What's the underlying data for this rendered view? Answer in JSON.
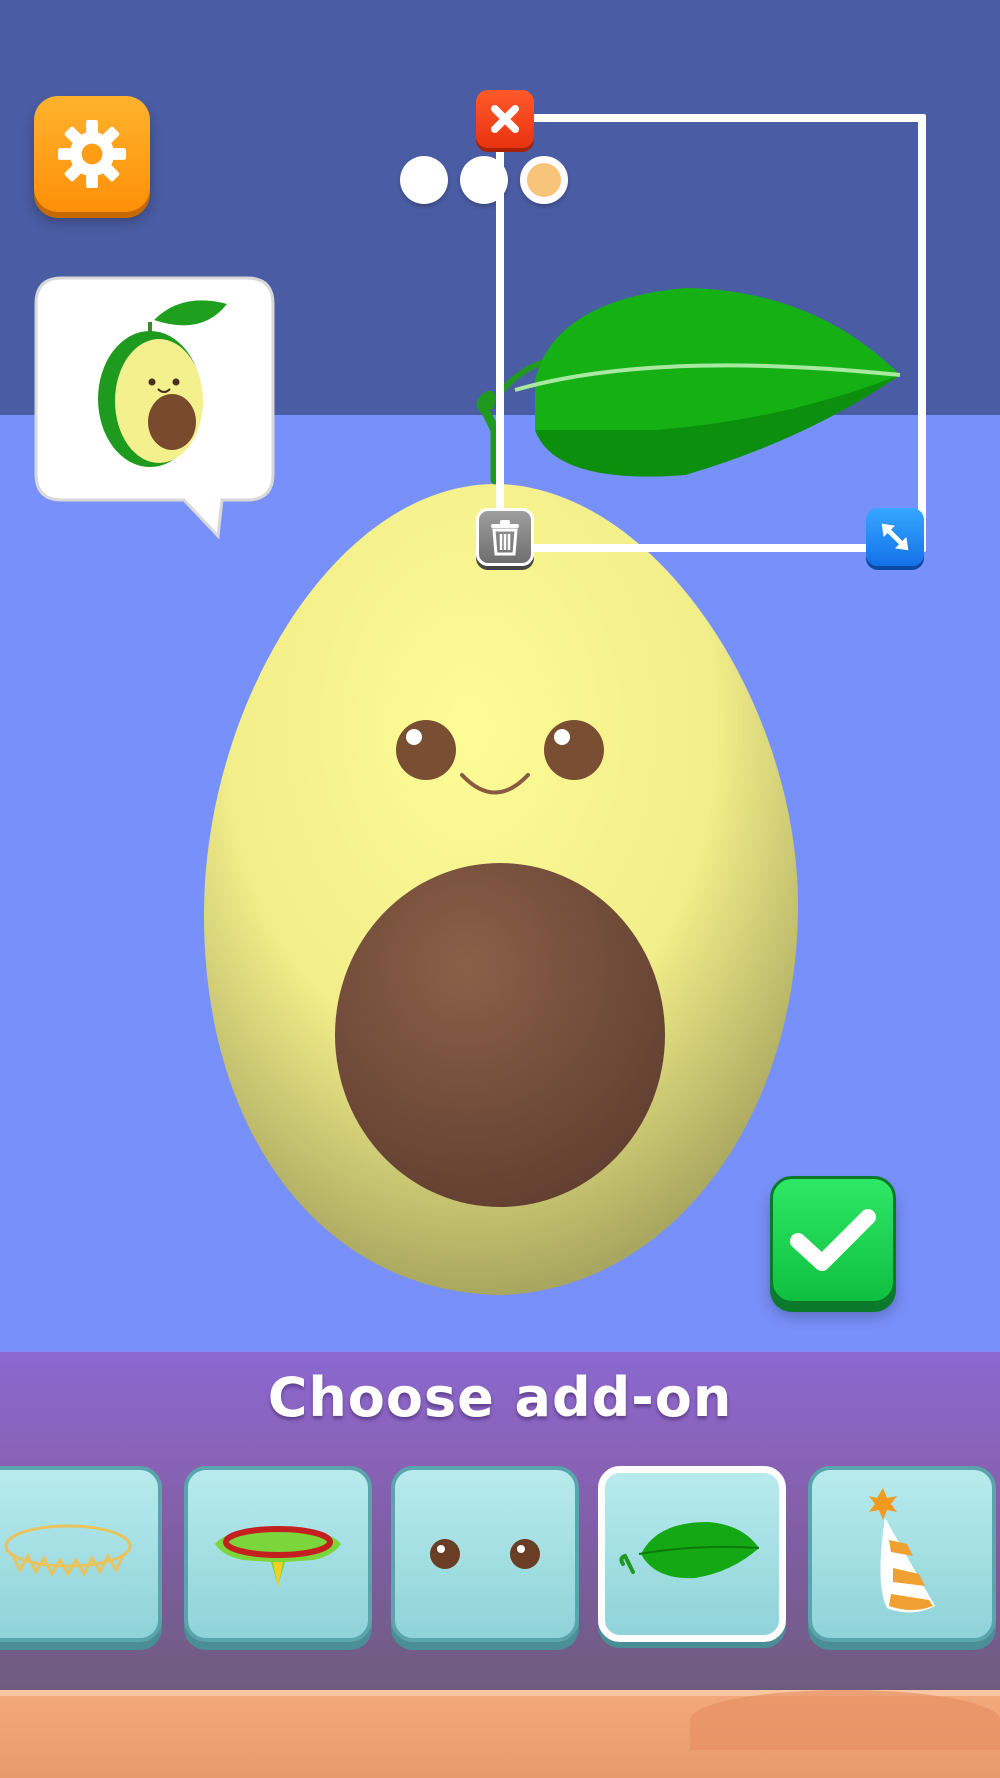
{
  "header": {
    "settings_icon": "gear-icon"
  },
  "preview": {
    "target_icon": "avocado-leaf-thumbnail"
  },
  "editor": {
    "color_dots": [
      {
        "color": "#ffffff",
        "selected": false
      },
      {
        "color": "#ffffff",
        "selected": false
      },
      {
        "color": "#f7c47a",
        "selected": true
      }
    ],
    "close_icon": "close-icon",
    "delete_icon": "trash-icon",
    "scale_icon": "resize-arrows-icon"
  },
  "confirm": {
    "icon": "checkmark-icon"
  },
  "addon_panel": {
    "title": "Choose add-on",
    "items": [
      {
        "name": "gold-crown-ring",
        "selected": false
      },
      {
        "name": "flower-collar",
        "selected": false
      },
      {
        "name": "eyes",
        "selected": false
      },
      {
        "name": "leaf",
        "selected": true
      },
      {
        "name": "party-hat",
        "selected": false
      }
    ]
  },
  "colors": {
    "wall": "#4a5ca3",
    "floor": "#7890fa",
    "accent_orange": "#ff9d14",
    "accent_green": "#15c94a"
  }
}
